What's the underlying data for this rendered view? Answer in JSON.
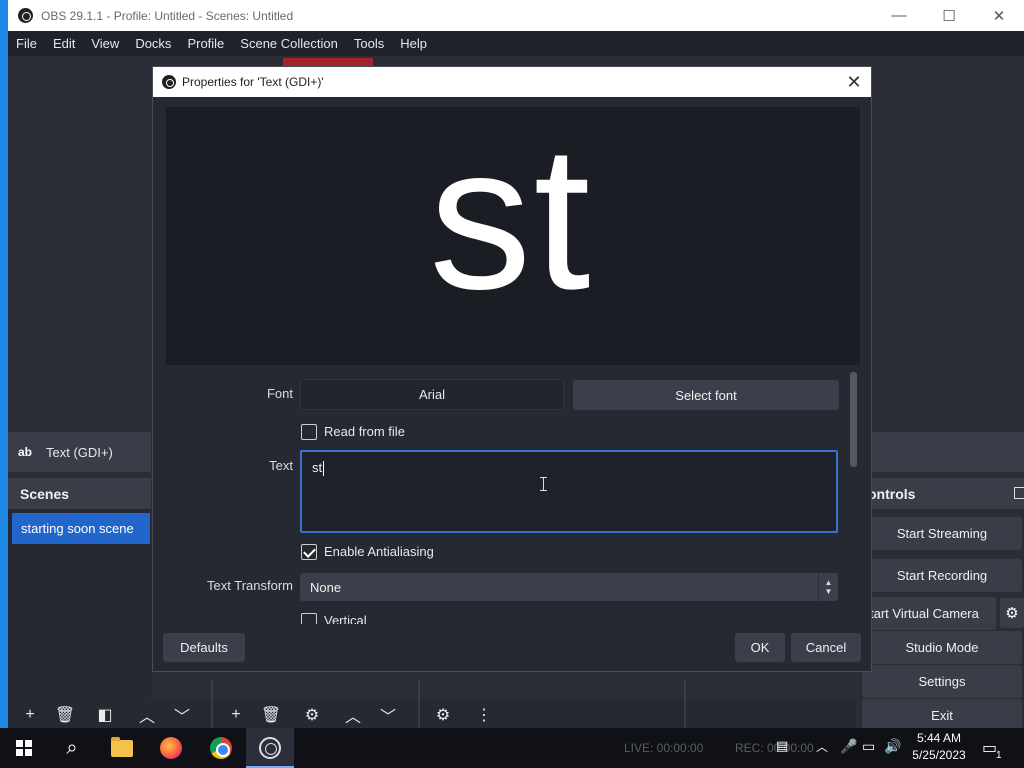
{
  "window": {
    "title": "OBS 29.1.1 - Profile: Untitled - Scenes: Untitled",
    "minimize": "—",
    "maximize": "☐",
    "close": "✕"
  },
  "menu": [
    "File",
    "Edit",
    "View",
    "Docks",
    "Profile",
    "Scene Collection",
    "Tools",
    "Help"
  ],
  "source": {
    "icon_text": "ab",
    "name": "Text (GDI+)"
  },
  "scenes": {
    "title": "Scenes",
    "items": [
      "starting soon scene"
    ]
  },
  "controls": {
    "title": "ontrols",
    "buttons": [
      "Start Streaming",
      "Start Recording",
      "tart Virtual Camera",
      "Studio Mode",
      "Settings",
      "Exit"
    ]
  },
  "dialog": {
    "title": "Properties for 'Text (GDI+)'",
    "close": "✕",
    "preview_text": "st",
    "font_label": "Font",
    "font_value": "Arial",
    "select_font": "Select font",
    "read_from_file": "Read from file",
    "read_from_file_checked": false,
    "text_label": "Text",
    "text_value": "st",
    "antialiasing": "Enable Antialiasing",
    "antialiasing_checked": true,
    "transform_label": "Text Transform",
    "transform_value": "None",
    "vertical": "Vertical",
    "defaults": "Defaults",
    "ok": "OK",
    "cancel": "Cancel"
  },
  "taskbar": {
    "live": "LIVE: 00:00:00",
    "rec": "REC: 00:00:00",
    "time": "5:44 AM",
    "date": "5/25/2023",
    "notifications": "1"
  },
  "icons": {
    "plus": "+",
    "trash": "🗑",
    "filter": "◧",
    "up": "︿",
    "down": "﹀",
    "gear": "⚙",
    "more": "⋮",
    "search": "⌕"
  }
}
